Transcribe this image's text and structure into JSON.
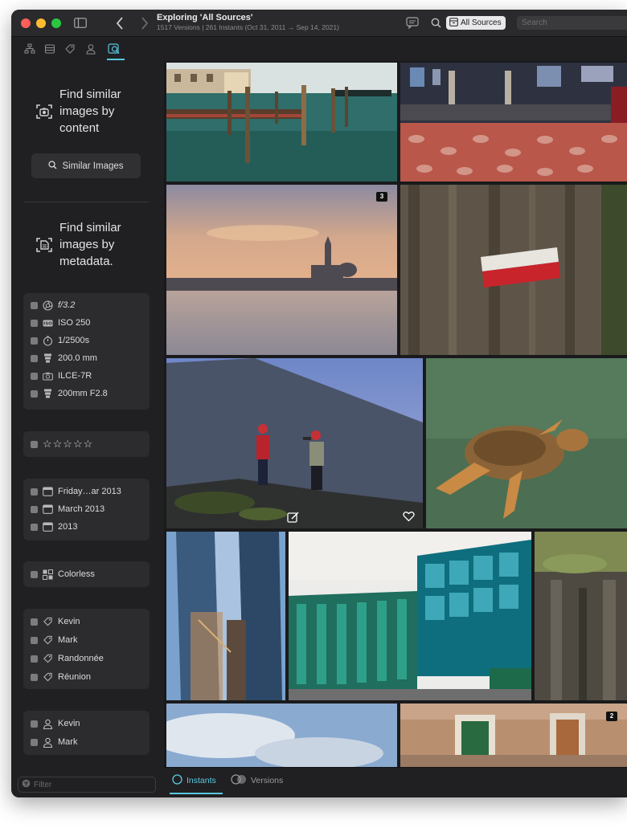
{
  "window": {
    "title": "Exploring 'All Sources'",
    "subtitle": "1517 Versions | 261 Instants (Oct 31, 2011 → Sep 14, 2021)"
  },
  "toolbar": {
    "sources_label": "All Sources",
    "search_placeholder": "Search"
  },
  "sidebar": {
    "find_content": "Find similar images by content",
    "similar_button": "Similar Images",
    "find_metadata": "Find similar images by metadata.",
    "exif": [
      {
        "icon": "aperture-icon",
        "label": "f/3.2"
      },
      {
        "icon": "iso-icon",
        "label": "ISO 250"
      },
      {
        "icon": "shutter-speed-icon",
        "label": "1/2500s"
      },
      {
        "icon": "focal-length-icon",
        "label": "200.0 mm"
      },
      {
        "icon": "camera-icon",
        "label": "ILCE-7R"
      },
      {
        "icon": "lens-icon",
        "label": "200mm F2.8"
      }
    ],
    "rating": "☆☆☆☆☆",
    "dates": [
      "Friday…ar 2013",
      "March 2013",
      "2013"
    ],
    "color": "Colorless",
    "keywords": [
      "Kevin",
      "Mark",
      "Randonnée",
      "Réunion"
    ],
    "people": [
      "Kevin",
      "Mark"
    ],
    "filter_placeholder": "Filter"
  },
  "grid": {
    "badges": [
      "3",
      "2"
    ]
  },
  "bottom": {
    "instants_label": "Instants",
    "versions_label": "Versions"
  },
  "colors": {
    "accent": "#5ac8e0",
    "window_bg": "#202022"
  }
}
